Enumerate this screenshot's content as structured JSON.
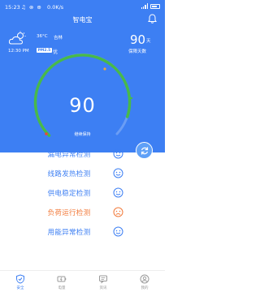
{
  "status_bar": {
    "time": "15:23",
    "icons_text": "♫ ⊗ ⊕",
    "net_speed": "0.0K/s"
  },
  "header": {
    "title": "智电宝"
  },
  "weather": {
    "icon": "partly-cloudy-icon",
    "temperature": "36°C",
    "city": "吉林",
    "time": "12:30 PM",
    "pm_badge": "PM2.5",
    "quality": "优"
  },
  "protection": {
    "days": "90",
    "unit": "天",
    "label": "保障天数"
  },
  "gauge": {
    "score": "90",
    "score_max": 100,
    "status": "继续保持"
  },
  "refresh_button": {
    "icon": "refresh-icon"
  },
  "checks": [
    {
      "label": "漏电异常检测",
      "state": "ok"
    },
    {
      "label": "线路发热检测",
      "state": "ok"
    },
    {
      "label": "供电稳定检测",
      "state": "ok"
    },
    {
      "label": "负荷运行检测",
      "state": "warn"
    },
    {
      "label": "用能异常检测",
      "state": "ok"
    }
  ],
  "tabs": [
    {
      "label": "安全",
      "icon": "shield-icon",
      "active": true
    },
    {
      "label": "电量",
      "icon": "battery-icon",
      "active": false
    },
    {
      "label": "资讯",
      "icon": "message-icon",
      "active": false
    },
    {
      "label": "我的",
      "icon": "person-icon",
      "active": false
    }
  ],
  "colors": {
    "primary": "#3d7ff3",
    "warning": "#f27a3a",
    "gauge_green": "#48b94a"
  }
}
